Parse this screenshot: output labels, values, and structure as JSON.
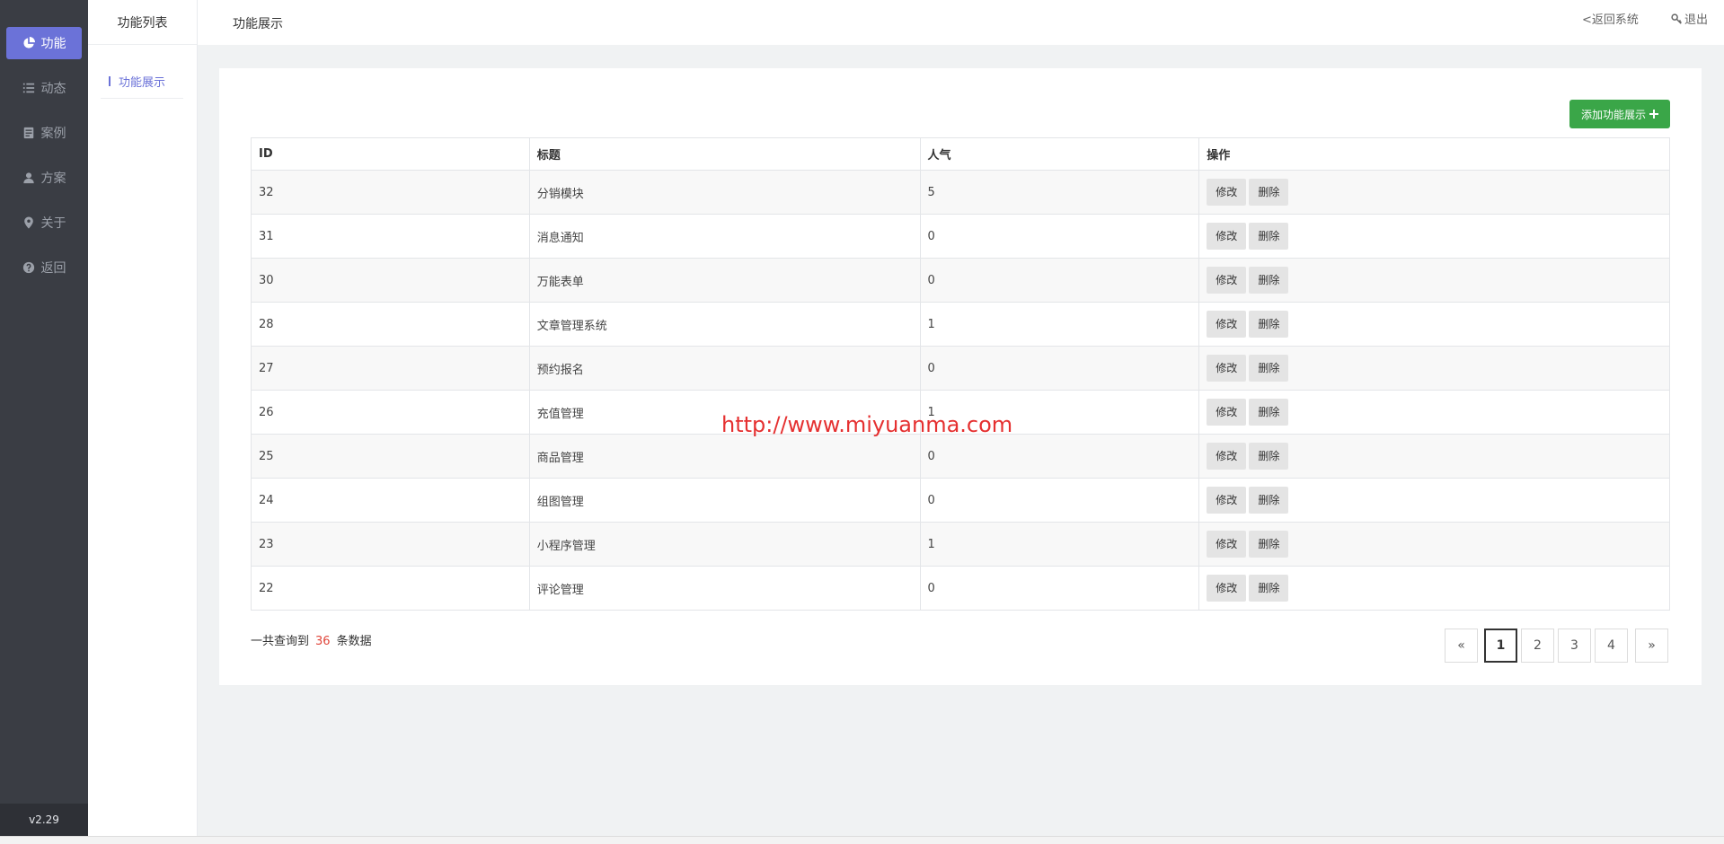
{
  "rail": {
    "items": [
      {
        "label": "功能",
        "icon": "pie-chart-icon",
        "active": true
      },
      {
        "label": "动态",
        "icon": "list-icon"
      },
      {
        "label": "案例",
        "icon": "document-icon"
      },
      {
        "label": "方案",
        "icon": "user-icon"
      },
      {
        "label": "关于",
        "icon": "map-pin-icon"
      },
      {
        "label": "返回",
        "icon": "help-circle-icon"
      }
    ],
    "version": "v2.29"
  },
  "sub_nav": {
    "title": "功能列表",
    "item": "功能展示"
  },
  "topbar": {
    "breadcrumb": "功能展示",
    "back_label": "<返回系统",
    "logout_label": "退出"
  },
  "toolbar": {
    "add_label": "添加功能展示"
  },
  "table": {
    "headers": [
      "ID",
      "标题",
      "人气",
      "操作"
    ],
    "rows": [
      {
        "id": "32",
        "title": "分销模块",
        "popularity": "5"
      },
      {
        "id": "31",
        "title": "消息通知",
        "popularity": "0"
      },
      {
        "id": "30",
        "title": "万能表单",
        "popularity": "0"
      },
      {
        "id": "28",
        "title": "文章管理系统",
        "popularity": "1"
      },
      {
        "id": "27",
        "title": "预约报名",
        "popularity": "0"
      },
      {
        "id": "26",
        "title": "充值管理",
        "popularity": "1"
      },
      {
        "id": "25",
        "title": "商品管理",
        "popularity": "0"
      },
      {
        "id": "24",
        "title": "组图管理",
        "popularity": "0"
      },
      {
        "id": "23",
        "title": "小程序管理",
        "popularity": "1"
      },
      {
        "id": "22",
        "title": "评论管理",
        "popularity": "0"
      }
    ],
    "edit_label": "修改",
    "delete_label": "删除"
  },
  "summary": {
    "prefix": "一共查询到",
    "count": "36",
    "suffix": "条数据"
  },
  "pagination": {
    "prev": "«",
    "pages": [
      "1",
      "2",
      "3",
      "4"
    ],
    "current": "1",
    "next": "»"
  },
  "watermark": "http://www.miyuanma.com",
  "colors": {
    "accent": "#6b72d8",
    "add_button": "#3aa648",
    "count_highlight": "#e0453a",
    "watermark": "#e53030"
  }
}
